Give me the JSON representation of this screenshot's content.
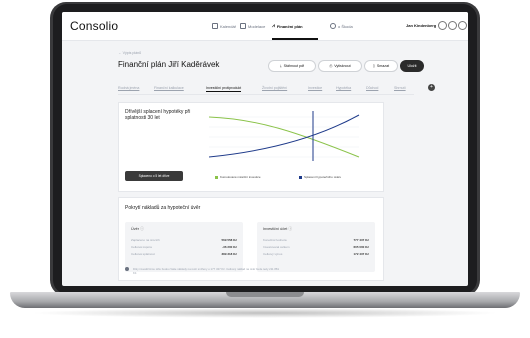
{
  "app": {
    "logo": "Consolio"
  },
  "nav": {
    "items": [
      {
        "label": "Kalendář",
        "icon": "calendar-icon"
      },
      {
        "label": "Modelace",
        "icon": "document-icon"
      },
      {
        "label": "Finanční plán",
        "icon": "chart-icon",
        "active": true
      },
      {
        "label": "o Škoda",
        "icon": "link-icon"
      }
    ],
    "user": "Jan Kindenberg"
  },
  "header": {
    "back_label": "← Výpis plánů",
    "title": "Finanční plán Jiří Kaděrávek",
    "buttons": {
      "export": "Stáhnout pdf",
      "print": "Vytisknout",
      "delete": "Smazat",
      "save": "Uložit"
    }
  },
  "tabs": [
    "Rodná jména",
    "Finanční kalkulace",
    "Investiční protiprodukt",
    "Životní pojištění",
    "Investice",
    "Hypotéka",
    "Důchod",
    "Shrnutí"
  ],
  "chart_card": {
    "title": "Dřívější splacení hypotéky při splatnosti 30 let",
    "calc_button": "Splaceno o 5 let dříve",
    "legend": [
      {
        "label": "Kumulované měsíční investice",
        "color": "#8bc34a"
      },
      {
        "label": "Splacení hypotečního úvěru",
        "color": "#1e3a8a"
      }
    ]
  },
  "chart_data": {
    "type": "line",
    "series": [
      {
        "name": "Kumulované měsíční investice",
        "color": "#8bc34a"
      },
      {
        "name": "Splacení hypotečního úvěru",
        "color": "#1e3a8a"
      }
    ]
  },
  "cover_card": {
    "title": "Pokrytí nákladů za hypoteční úvěr",
    "loan": {
      "heading": "Úvěr",
      "rows": [
        {
          "label": "Zaplaceno na úrocích",
          "value": "569 558 Kč"
        },
        {
          "label": "Celková úspora",
          "value": "-36 200 Kč"
        },
        {
          "label": "Celková splatnost",
          "value": "389 318 Kč"
        }
      ]
    },
    "invest": {
      "heading": "Investiční účet",
      "rows": [
        {
          "label": "Konečná hodnota",
          "value": "777 437 Kč"
        },
        {
          "label": "Investovaná celkem",
          "value": "605 000 Kč"
        },
        {
          "label": "Celkový výnos",
          "value": "172 437 Kč"
        }
      ]
    },
    "note": "Díky investičnímu účtu budou Vaše náklady na úvěr sníženy o 177 437 Kč. Celkový náklad na úvěr bude tedy 211 881 Kč."
  }
}
